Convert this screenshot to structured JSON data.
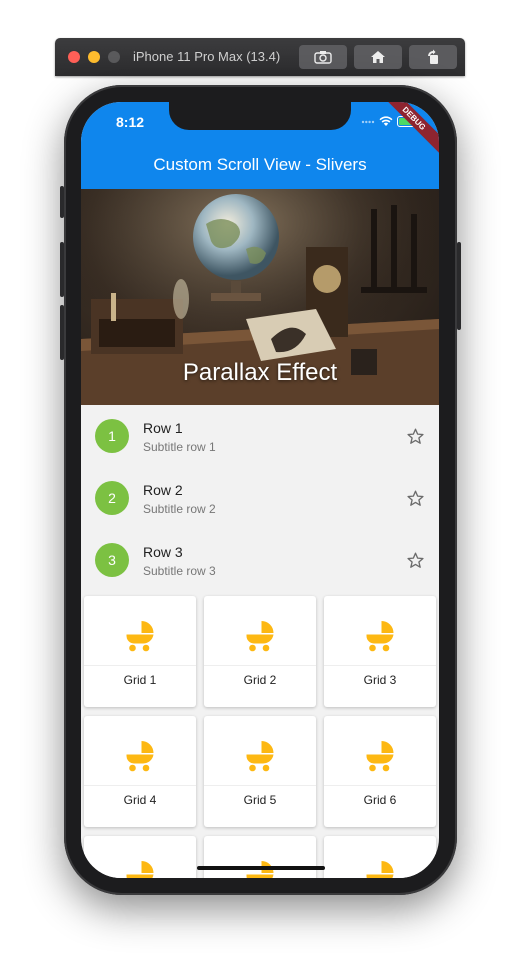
{
  "simulator": {
    "title": "iPhone 11 Pro Max (13.4)"
  },
  "status_bar": {
    "time": "8:12",
    "debug_label": "DEBUG"
  },
  "app_bar": {
    "title": "Custom Scroll View - Slivers",
    "color": "#0f86ed"
  },
  "header": {
    "title": "Parallax Effect"
  },
  "list": {
    "avatar_color": "#7cc142",
    "rows": [
      {
        "number": "1",
        "title": "Row 1",
        "subtitle": "Subtitle row 1",
        "trailing_icon": "star-outline-icon"
      },
      {
        "number": "2",
        "title": "Row 2",
        "subtitle": "Subtitle row 2",
        "trailing_icon": "star-outline-icon"
      },
      {
        "number": "3",
        "title": "Row 3",
        "subtitle": "Subtitle row 3",
        "trailing_icon": "star-outline-icon"
      }
    ]
  },
  "grid": {
    "icon": "stroller-icon",
    "icon_color": "#fdb813",
    "items": [
      {
        "label": "Grid 1"
      },
      {
        "label": "Grid 2"
      },
      {
        "label": "Grid 3"
      },
      {
        "label": "Grid 4"
      },
      {
        "label": "Grid 5"
      },
      {
        "label": "Grid 6"
      }
    ]
  }
}
